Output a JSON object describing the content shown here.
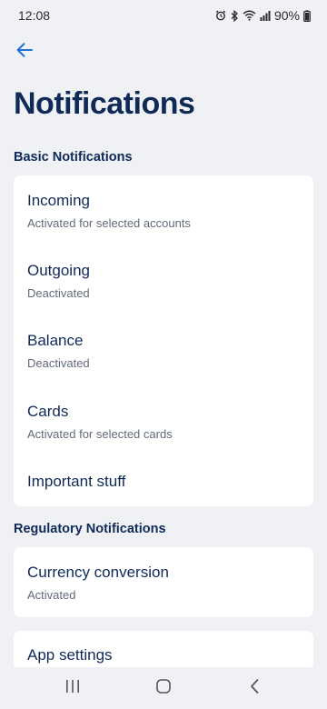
{
  "status_bar": {
    "time": "12:08",
    "battery": "90%",
    "icons": [
      "alarm-icon",
      "bluetooth-icon",
      "wifi-icon",
      "signal-icon"
    ]
  },
  "header": {
    "back_icon": "arrow-left-icon",
    "title": "Notifications"
  },
  "basic_section": {
    "title": "Basic Notifications",
    "items": [
      {
        "title": "Incoming",
        "subtitle": "Activated for selected accounts"
      },
      {
        "title": "Outgoing",
        "subtitle": "Deactivated"
      },
      {
        "title": "Balance",
        "subtitle": "Deactivated"
      },
      {
        "title": "Cards",
        "subtitle": "Activated for selected cards"
      },
      {
        "title": "Important stuff"
      }
    ]
  },
  "regulatory_section": {
    "title": "Regulatory Notifications",
    "items": [
      {
        "title": "Currency conversion",
        "subtitle": "Activated"
      }
    ]
  },
  "app_settings": {
    "title": "App settings"
  },
  "nav_bar": {
    "buttons": [
      "recents-icon",
      "home-icon",
      "back-nav-icon"
    ]
  },
  "colors": {
    "background": "#F0F1F4",
    "card": "#FFFFFF",
    "primary_text": "#0F2A57",
    "secondary_text": "#626B7A",
    "accent": "#1F6FD8"
  }
}
